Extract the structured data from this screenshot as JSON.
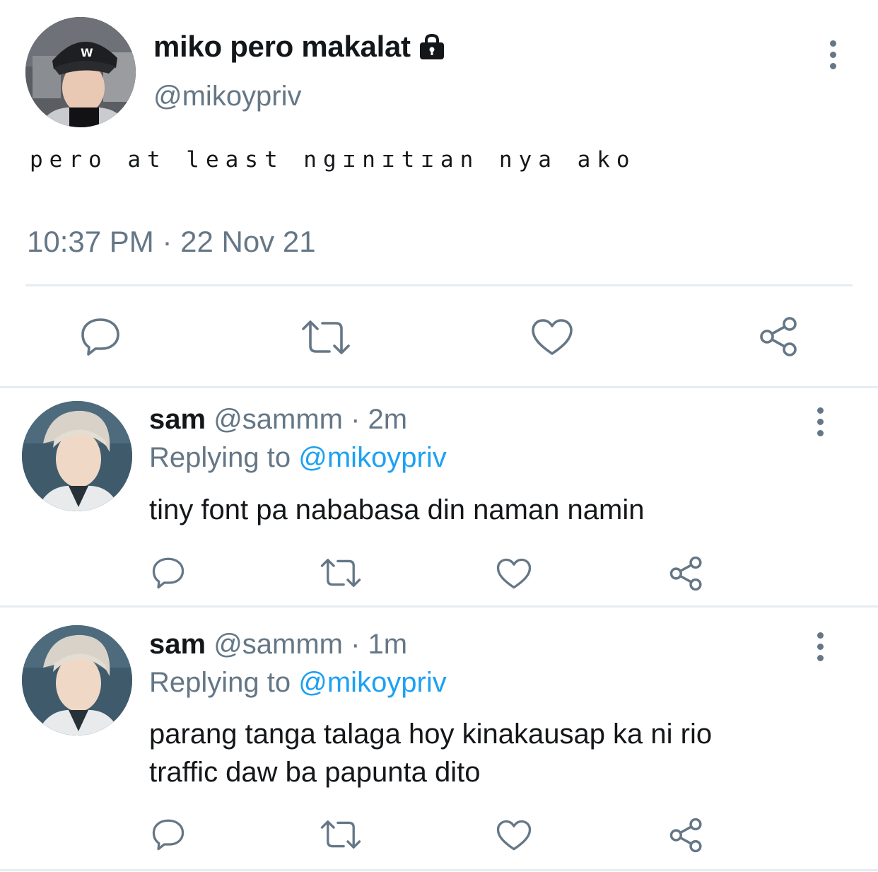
{
  "main_tweet": {
    "display_name": "miko pero makalat",
    "handle": "@mikoypriv",
    "text": "pero at least ngɪnɪtɪan nya ako",
    "timestamp": "10:37 PM · 22 Nov 21",
    "icons": [
      "lock-icon",
      "more-icon",
      "reply-icon",
      "retweet-icon",
      "like-icon",
      "share-icon"
    ]
  },
  "replies": [
    {
      "name": "sam",
      "handle": "@sammm",
      "time": "· 2m",
      "replying_prefix": "Replying to",
      "replying_to": "@mikoypriv",
      "text": "tiny font pa nababasa din naman namin"
    },
    {
      "name": "sam",
      "handle": "@sammm",
      "time": "· 1m",
      "replying_prefix": "Replying to",
      "replying_to": "@mikoypriv",
      "text_line1": "parang tanga talaga hoy kinakausap ka ni rio",
      "text_line2": "traffic daw ba papunta dito"
    }
  ],
  "colors": {
    "text": "#14171a",
    "muted": "#657786",
    "link": "#1da1f2",
    "divider": "#e6ecf0"
  }
}
